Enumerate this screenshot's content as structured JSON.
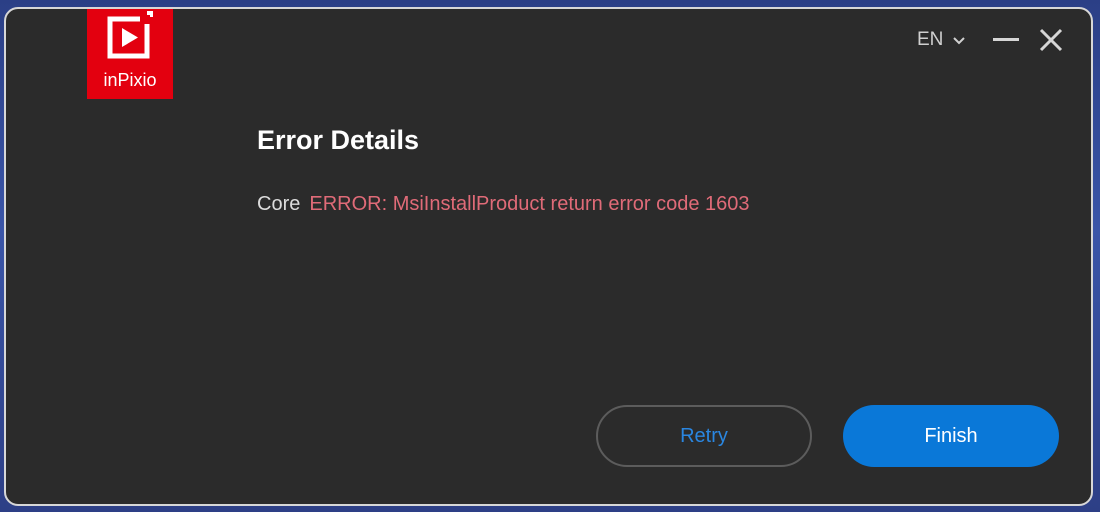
{
  "app": {
    "logo_text": "inPixio",
    "brand_color": "#e3000f"
  },
  "header": {
    "language": "EN",
    "icons": [
      "chevron-down-icon",
      "minimize-icon",
      "close-icon"
    ]
  },
  "content": {
    "title": "Error Details",
    "component_label": "Core",
    "error_message": "ERROR: MsiInstallProduct return error code 1603",
    "error_color": "#e06b78"
  },
  "buttons": {
    "retry_label": "Retry",
    "finish_label": "Finish",
    "accent_color": "#0a78d8"
  }
}
